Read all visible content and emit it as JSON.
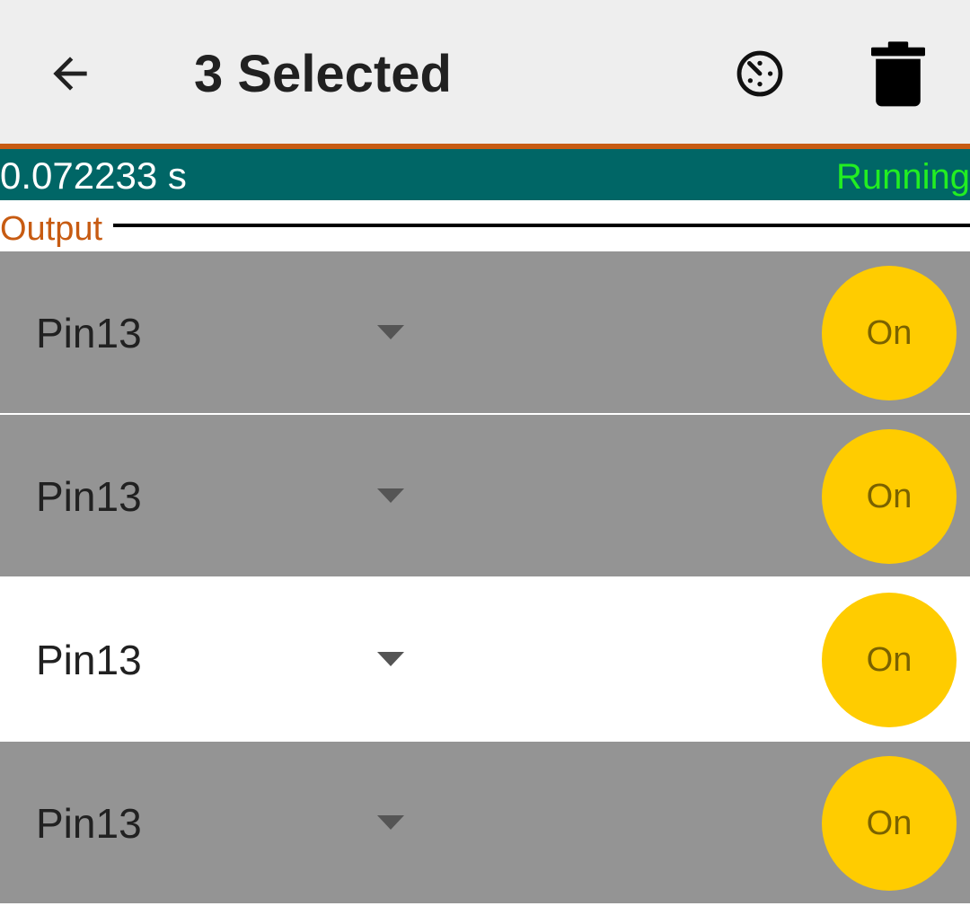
{
  "colors": {
    "appbar_bg": "#eeeeee",
    "accent": "#c75b12",
    "status_bg": "#006666",
    "running": "#22ee22",
    "section_label": "#c75b12",
    "selected_row": "#949494",
    "toggle": "#ffcc00"
  },
  "appbar": {
    "back_icon": "arrow-back-icon",
    "title": "3 Selected",
    "timer_icon": "timer-icon",
    "delete_icon": "trash-icon"
  },
  "status": {
    "elapsed": "0.072233 s",
    "state": "Running"
  },
  "section": {
    "label": "Output"
  },
  "rows": [
    {
      "pin": "Pin13",
      "toggle": "On",
      "selected": true
    },
    {
      "pin": "Pin13",
      "toggle": "On",
      "selected": true
    },
    {
      "pin": "Pin13",
      "toggle": "On",
      "selected": false
    },
    {
      "pin": "Pin13",
      "toggle": "On",
      "selected": true
    }
  ]
}
